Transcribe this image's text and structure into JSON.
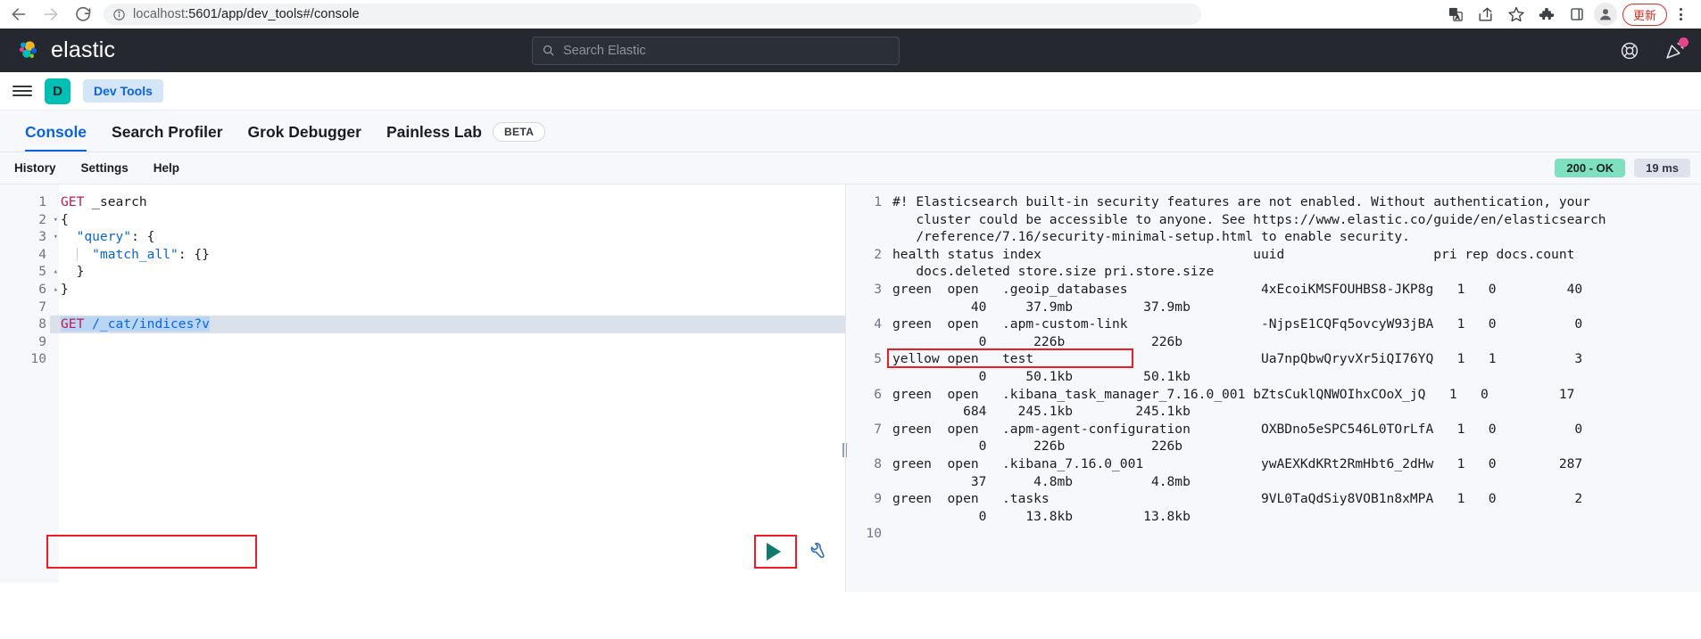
{
  "browser": {
    "back_label": "back-navigation",
    "forward_label": "forward-navigation",
    "reload_label": "reload-page",
    "url_scheme": "localhost",
    "url_rest": ":5601/app/dev_tools#/console",
    "update_button": "更新",
    "icons": {
      "site_info": "info-circle-icon",
      "translate": "translate-icon",
      "share": "share-icon",
      "bookmark": "star-icon",
      "extensions": "puzzle-icon",
      "side_panel": "side-panel-icon",
      "profile": "profile-avatar-icon",
      "menu": "kebab-menu-icon"
    }
  },
  "header": {
    "brand": "elastic",
    "search_placeholder": "Search Elastic",
    "help_icon": "lifebuoy-help-icon",
    "news_icon": "announcement-icon",
    "accent_dark": "#25282f",
    "notification_color": "#e7438e"
  },
  "breadcrumb": {
    "space_initial": "D",
    "space_color": "#00bfb3",
    "app_name": "Dev Tools"
  },
  "tabs": [
    {
      "label": "Console",
      "active": true
    },
    {
      "label": "Search Profiler",
      "active": false
    },
    {
      "label": "Grok Debugger",
      "active": false
    },
    {
      "label": "Painless Lab",
      "active": false,
      "badge": "BETA"
    }
  ],
  "console_toolbar": {
    "links": [
      "History",
      "Settings",
      "Help"
    ],
    "status_badge": "200 - OK",
    "time_badge": "19 ms",
    "status_color": "#7fe0bf"
  },
  "editor": {
    "run_button_title": "send-request",
    "wrench_title": "request-options",
    "lines": [
      {
        "num": "1",
        "fold": "",
        "html": "<span class='kw'>GET</span> <span class='punc'>_search</span>"
      },
      {
        "num": "2",
        "fold": "down",
        "html": "<span class='punc'>{</span>"
      },
      {
        "num": "3",
        "fold": "down",
        "html": "  <span class='str'>\"query\"</span><span class='punc'>: {</span>"
      },
      {
        "num": "4",
        "fold": "",
        "html": "  <span class='indent-guide'></span>  <span class='str'>\"match_all\"</span><span class='punc'>: {}</span>"
      },
      {
        "num": "5",
        "fold": "up",
        "html": "  <span class='punc'>}</span>"
      },
      {
        "num": "6",
        "fold": "up",
        "html": "<span class='punc'>}</span>"
      },
      {
        "num": "7",
        "fold": "",
        "html": ""
      },
      {
        "num": "8",
        "fold": "",
        "html": "<span class='sel'><span class='kw'>GET</span> <span class='url'>/_cat/indices?v</span></span>",
        "active": true
      },
      {
        "num": "9",
        "fold": "",
        "html": ""
      },
      {
        "num": "10",
        "fold": "",
        "html": ""
      }
    ]
  },
  "response": {
    "rows": [
      {
        "num": "1",
        "text": "#! Elasticsearch built-in security features are not enabled. Without authentication, your\n   cluster could be accessible to anyone. See https://www.elastic.co/guide/en/elasticsearch\n   /reference/7.16/security-minimal-setup.html to enable security."
      },
      {
        "num": "2",
        "text": "health status index                           uuid                   pri rep docs.count\n   docs.deleted store.size pri.store.size"
      },
      {
        "num": "3",
        "text": "green  open   .geoip_databases                 4xEcoiKMSFOUHBS8-JKP8g   1   0         40\n          40     37.9mb         37.9mb"
      },
      {
        "num": "4",
        "text": "green  open   .apm-custom-link                 -NjpsE1CQFq5ovcyW93jBA   1   0          0\n           0      226b           226b"
      },
      {
        "num": "5",
        "text": "yellow open   test                             Ua7npQbwQryvXr5iQI76YQ   1   1          3\n           0     50.1kb         50.1kb",
        "highlight": true
      },
      {
        "num": "6",
        "text": "green  open   .kibana_task_manager_7.16.0_001 bZtsCuklQNWOIhxCOoX_jQ   1   0         17\n         684    245.1kb        245.1kb"
      },
      {
        "num": "7",
        "text": "green  open   .apm-agent-configuration         OXBDno5eSPC546L0TOrLfA   1   0          0\n           0      226b           226b"
      },
      {
        "num": "8",
        "text": "green  open   .kibana_7.16.0_001               ywAEXKdKRt2RmHbt6_2dHw   1   0        287\n          37      4.8mb          4.8mb"
      },
      {
        "num": "9",
        "text": "green  open   .tasks                           9VL0TaQdSiy8VOB1n8xMPA   1   0          2\n           0     13.8kb         13.8kb"
      },
      {
        "num": "10",
        "text": ""
      }
    ]
  },
  "annotations": {
    "color": "#ee1c25",
    "boxes": [
      "editor-line-8",
      "run-button",
      "response-line-5"
    ]
  }
}
